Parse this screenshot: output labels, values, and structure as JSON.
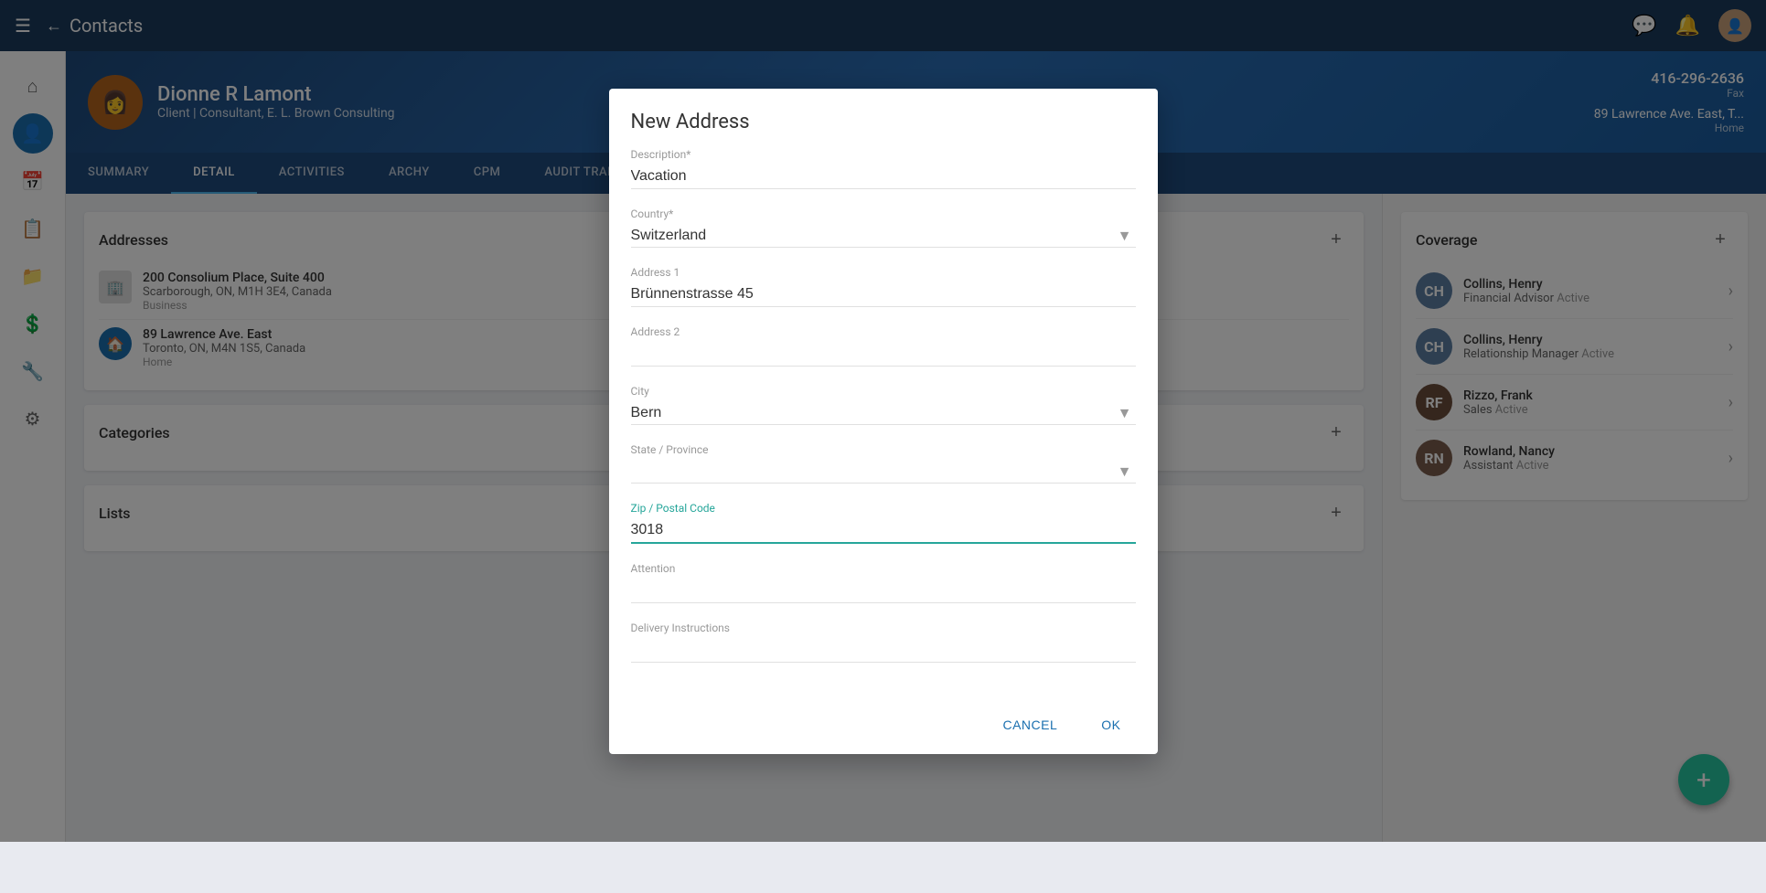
{
  "app": {
    "title": "Contacts",
    "back_label": "←",
    "hamburger": "☰"
  },
  "topnav": {
    "title": "Contacts",
    "icons": {
      "chat": "💬",
      "bell": "🔔"
    }
  },
  "sidebar": {
    "items": [
      {
        "name": "home",
        "icon": "⌂",
        "active": false
      },
      {
        "name": "contact",
        "icon": "👤",
        "active": true
      },
      {
        "name": "calendar",
        "icon": "📅",
        "active": false
      },
      {
        "name": "clipboard",
        "icon": "📋",
        "active": false
      },
      {
        "name": "folder",
        "icon": "📁",
        "active": false
      },
      {
        "name": "dollar",
        "icon": "💲",
        "active": false
      },
      {
        "name": "wrench",
        "icon": "🔧",
        "active": false
      },
      {
        "name": "gear",
        "icon": "⚙",
        "active": false
      }
    ]
  },
  "contact": {
    "name": "Dionne R Lamont",
    "subtitle": "Client | Consultant, E. L. Brown Consulting",
    "phone": "416-296-2636",
    "phone_label": "Fax",
    "address_preview": "89 Lawrence Ave. East, T...",
    "address_label": "Home"
  },
  "tabs": [
    {
      "label": "SUMMARY",
      "active": false
    },
    {
      "label": "DETAIL",
      "active": true
    },
    {
      "label": "ACTIVITIES",
      "active": false
    },
    {
      "label": "ARCHY",
      "active": false
    },
    {
      "label": "CPM",
      "active": false
    },
    {
      "label": "AUDIT TRAIL",
      "active": false
    }
  ],
  "addresses_card": {
    "title": "Addresses",
    "add_icon": "+",
    "items": [
      {
        "icon": "🏢",
        "icon_type": "business",
        "name": "200 Consolium Place, Suite 400",
        "line": "Scarborough, ON, M1H 3E4, Canada",
        "type": "Business"
      },
      {
        "icon": "🏠",
        "icon_type": "home",
        "name": "89 Lawrence Ave. East",
        "line": "Toronto, ON, M4N 1S5, Canada",
        "type": "Home"
      }
    ]
  },
  "categories_card": {
    "title": "Categories",
    "add_icon": "+"
  },
  "lists_card": {
    "title": "Lists",
    "add_icon": "+"
  },
  "coverage_card": {
    "title": "Coverage",
    "add_icon": "+",
    "items": [
      {
        "name": "Collins, Henry",
        "role": "Financial Advisor",
        "status": "Active",
        "color": "#5c7fa3"
      },
      {
        "name": "Collins, Henry",
        "role": "Relationship Manager",
        "status": "Active",
        "color": "#5c7fa3"
      },
      {
        "name": "Rizzo, Frank",
        "role": "Sales",
        "status": "Active",
        "color": "#6b4c3b"
      },
      {
        "name": "Rowland, Nancy",
        "role": "Assistant",
        "status": "Active",
        "color": "#7a5c4c"
      }
    ]
  },
  "modal": {
    "title": "New Address",
    "fields": {
      "description_label": "Description*",
      "description_value": "Vacation",
      "country_label": "Country*",
      "country_value": "Switzerland",
      "address1_label": "Address 1",
      "address1_value": "Brünnenstrasse 45",
      "address2_label": "Address 2",
      "address2_value": "",
      "city_label": "City",
      "city_value": "Bern",
      "state_label": "State / Province",
      "state_value": "",
      "zip_label": "Zip / Postal Code",
      "zip_value": "3018",
      "attention_label": "Attention",
      "attention_value": "",
      "delivery_label": "Delivery Instructions",
      "delivery_value": ""
    },
    "buttons": {
      "cancel": "CANCEL",
      "ok": "OK"
    }
  },
  "fab": {
    "icon": "+"
  }
}
